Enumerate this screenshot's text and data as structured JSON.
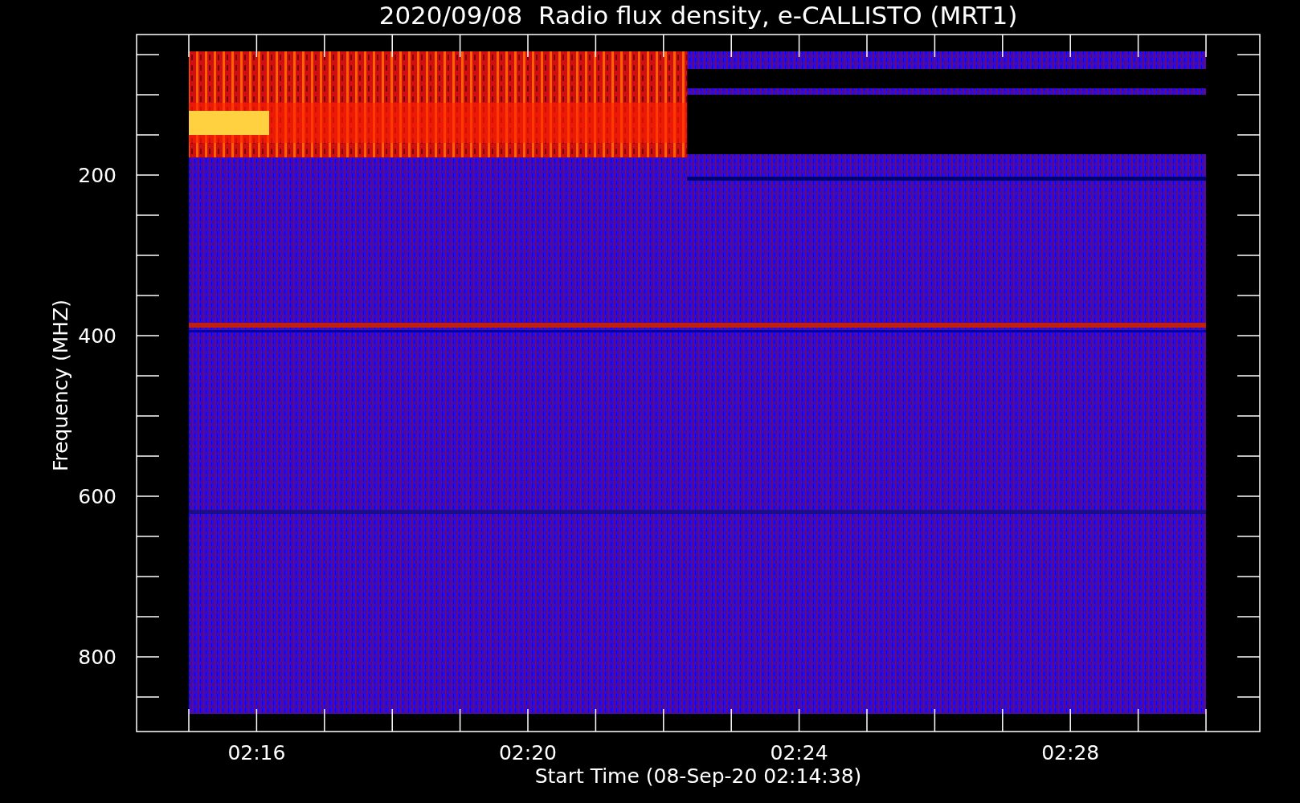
{
  "title": "2020/09/08  Radio flux density, e-CALLISTO (MRT1)",
  "y_axis": {
    "label": "Frequency (MHZ)",
    "ticks": [
      "200",
      "400",
      "600",
      "800"
    ]
  },
  "x_axis": {
    "label": "Start Time (08-Sep-20 02:14:38)",
    "ticks": [
      "02:16",
      "02:20",
      "02:24",
      "02:28"
    ]
  }
}
